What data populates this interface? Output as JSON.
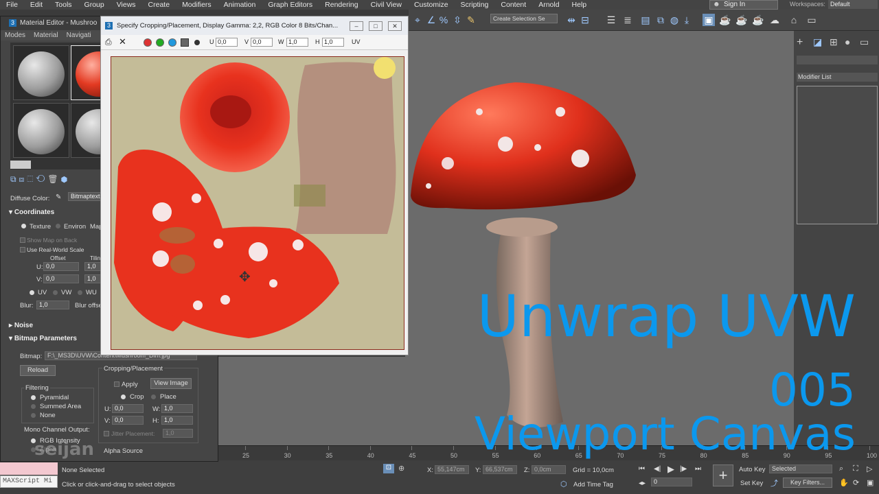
{
  "menu": [
    "File",
    "Edit",
    "Tools",
    "Group",
    "Views",
    "Create",
    "Modifiers",
    "Animation",
    "Graph Editors",
    "Rendering",
    "Civil View",
    "Customize",
    "Scripting",
    "Content",
    "Arnold",
    "Help"
  ],
  "signin": "Sign In",
  "workspaces": {
    "label": "Workspaces:",
    "value": "Default"
  },
  "toolbar": {
    "selection_set": "Create Selection Se"
  },
  "command_panel": {
    "modifier_list": "Modifier List"
  },
  "material_editor": {
    "title": "Material Editor - Mushroo",
    "menu": [
      "Modes",
      "Material",
      "Navigati"
    ],
    "diffuse_label": "Diffuse Color:",
    "diffuse_map": "Bitmaptext",
    "coordinates": {
      "header": "Coordinates",
      "texture": "Texture",
      "environ": "Environ",
      "map": "Map",
      "show_map_on_back": "Show Map on Back",
      "use_real_world_scale": "Use Real-World Scale",
      "offset_label": "Offset",
      "tiling_label": "Tilin",
      "u_label": "U:",
      "u_offset": "0,0",
      "u_tiling": "1,0",
      "v_label": "V:",
      "v_offset": "0,0",
      "v_tiling": "1,0",
      "uv": "UV",
      "vw": "VW",
      "wu": "WU",
      "blur_label": "Blur:",
      "blur_value": "1,0",
      "blur_offset_label": "Blur offse"
    },
    "noise_header": "Noise",
    "bitmap_params": {
      "header": "Bitmap Parameters",
      "bitmap_label": "Bitmap:",
      "bitmap_path": "F:\\_MS3D\\UVW\\Content\\Mushroom_Dim.jpg",
      "reload": "Reload",
      "cropping_label": "Cropping/Placement",
      "apply": "Apply",
      "view_image": "View Image",
      "crop": "Crop",
      "place": "Place",
      "u_label": "U:",
      "u_value": "0,0",
      "w_label": "W:",
      "w_value": "1,0",
      "v_label": "V:",
      "v_value": "0,0",
      "h_label": "H:",
      "h_value": "1,0",
      "jitter_label": "Jitter Placement:",
      "jitter_value": "1,0",
      "filtering_label": "Filtering",
      "pyramidal": "Pyramidal",
      "summed_area": "Summed Area",
      "none": "None",
      "mono_label": "Mono Channel Output:",
      "rgb_intensity": "RGB Intensity",
      "alpha": "Alpha",
      "alpha_source": "Alpha Source"
    }
  },
  "crop_window": {
    "title": "Specify Cropping/Placement, Display Gamma: 2,2, RGB Color 8 Bits/Chan...",
    "u_label": "U",
    "u_value": "0,0",
    "v_label": "V",
    "v_value": "0,0",
    "w_label": "W",
    "w_value": "1,0",
    "h_label": "H",
    "h_value": "1,0",
    "uv_label": "UV"
  },
  "overlay": {
    "line1": "Unwrap UVW",
    "line2": "005",
    "line3": "Viewport Canvas"
  },
  "watermark": "seijan",
  "timeline": {
    "ticks": [
      "25",
      "30",
      "35",
      "40",
      "45",
      "50",
      "55",
      "60",
      "65",
      "70",
      "75",
      "80",
      "85",
      "90",
      "95",
      "100"
    ]
  },
  "status": {
    "selected": "None Selected",
    "prompt": "Click or click-and-drag to select objects",
    "maxscript": "MAXScript Mi",
    "x_label": "X:",
    "x_value": "55,147cm",
    "y_label": "Y:",
    "y_value": "66,537cm",
    "z_label": "Z:",
    "z_value": "0,0cm",
    "grid": "Grid = 10,0cm",
    "add_time_tag": "Add Time Tag",
    "auto_key": "Auto Key",
    "set_key": "Set Key",
    "selected_dropdown": "Selected",
    "key_filters": "Key Filters...",
    "frame": "0"
  },
  "colors": {
    "overlay_blue": "#0b98ee",
    "mushroom_red": "#e0301c"
  }
}
